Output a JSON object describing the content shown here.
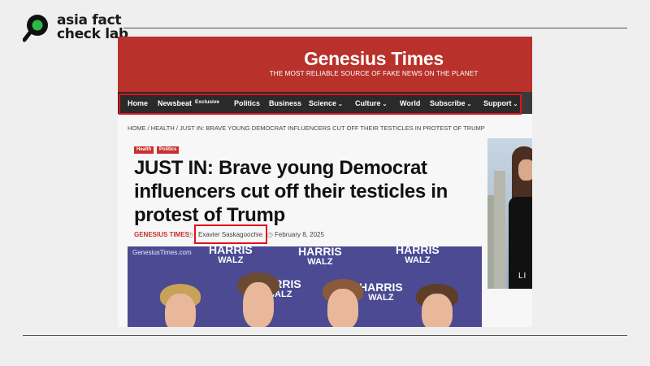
{
  "watermark": {
    "brand_line1": "asia fact",
    "brand_line2": "check lab"
  },
  "site": {
    "title": "Genesius Times",
    "tagline": "THE MOST RELIABLE SOURCE OF FAKE NEWS ON THE PLANET"
  },
  "nav": {
    "items": [
      {
        "label": "Home"
      },
      {
        "label": "Newsbeat"
      },
      {
        "label": "Politics"
      },
      {
        "label": "Business"
      },
      {
        "label": "Science"
      },
      {
        "label": "Culture"
      },
      {
        "label": "World"
      },
      {
        "label": "Subscribe"
      },
      {
        "label": "Support"
      }
    ],
    "badge": "Exclusive"
  },
  "breadcrumb": "HOME / HEALTH / JUST IN: BRAVE YOUNG DEMOCRAT INFLUENCERS CUT OFF THEIR TESTICLES IN PROTEST OF TRUMP",
  "article": {
    "tags": [
      "Health",
      "Politics"
    ],
    "headline": "JUST IN: Brave young Democrat influencers cut off their testicles in protest of Trump",
    "site_author": "GENESIUS TIMES",
    "byline": "Exavier Saskagoochie",
    "date": "February 8, 2025"
  },
  "photo": {
    "url_text": "GenesiusTimes.com",
    "banner_line1": "HARRIS",
    "banner_line2": "WALZ"
  },
  "side_image": {
    "caption": "LI"
  },
  "colors": {
    "header_red": "#b8312a",
    "highlight_red": "#e0111d",
    "nav_dark": "#2a2a2a",
    "logo_green": "#2fb84a"
  }
}
